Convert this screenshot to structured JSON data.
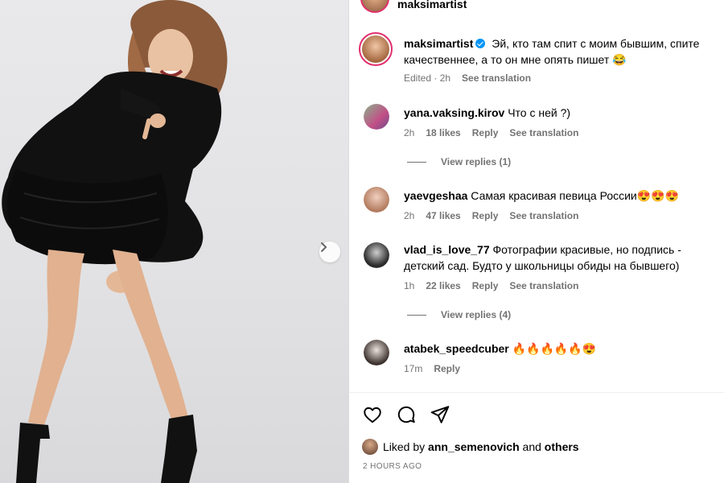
{
  "post": {
    "header_username": "maksimartist",
    "caption_username": "maksimartist",
    "caption_text": "Эй, кто там спит с моим бывшим, спите качественнее, а то он мне опять пишет 😂",
    "caption_meta_time": "Edited · 2h",
    "caption_see_translation": "See translation"
  },
  "comments": [
    {
      "username": "yana.vaksing.kirov",
      "text": "Что с ней ?)",
      "time": "2h",
      "likes": "18 likes",
      "reply": "Reply",
      "see_translation": "See translation",
      "view_replies": "View replies (1)"
    },
    {
      "username": "yaevgeshaa",
      "text": "Самая красивая певица России😍😍😍",
      "time": "2h",
      "likes": "47 likes",
      "reply": "Reply",
      "see_translation": "See translation"
    },
    {
      "username": "vlad_is_love_77",
      "text": "Фотографии красивые, но подпись - детский сад. Будто у школьницы обиды на бывшего)",
      "time": "1h",
      "likes": "22 likes",
      "reply": "Reply",
      "see_translation": "See translation",
      "view_replies": "View replies (4)"
    },
    {
      "username": "atabek_speedcuber",
      "text": "🔥🔥🔥🔥🔥😍",
      "time": "17m",
      "reply": "Reply"
    }
  ],
  "likes_bar": {
    "prefix": "Liked by",
    "user": "ann_semenovich",
    "and": "and",
    "others": "others"
  },
  "timestamp": "2 HOURS AGO",
  "icons": {
    "like": "heart-icon",
    "comment": "comment-icon",
    "share": "share-icon",
    "next": "chevron-right-icon",
    "verified": "verified-badge-icon"
  },
  "colors": {
    "verified": "#0095f6",
    "story_ring": "#e1306c",
    "secondary_text": "#737373"
  }
}
